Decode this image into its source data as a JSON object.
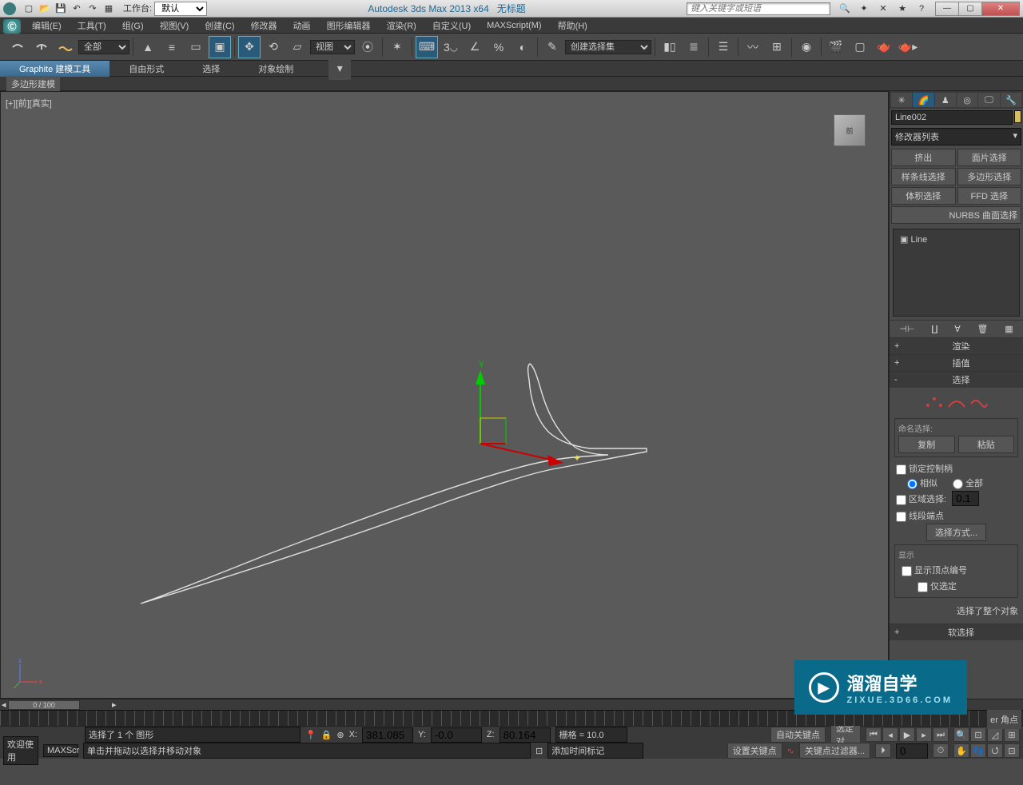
{
  "title": {
    "app": "Autodesk 3ds Max  2013 x64",
    "doc": "无标题",
    "workspace_label": "工作台:",
    "workspace_value": "默认",
    "search_placeholder": "键入关键字或短语"
  },
  "menus": [
    "编辑(E)",
    "工具(T)",
    "组(G)",
    "视图(V)",
    "创建(C)",
    "修改器",
    "动画",
    "图形编辑器",
    "渲染(R)",
    "自定义(U)",
    "MAXScript(M)",
    "帮助(H)"
  ],
  "toolbar": {
    "filter_all": "全部",
    "view_dropdown": "视图",
    "selection_set": "创建选择集"
  },
  "ribbon": {
    "tabs": [
      "Graphite 建模工具",
      "自由形式",
      "选择",
      "对象绘制"
    ],
    "sub": "多边形建模"
  },
  "viewport": {
    "label": "[+][前][真实]",
    "cube": "前"
  },
  "panel": {
    "object_name": "Line002",
    "modifier_list": "修改器列表",
    "buttons": [
      "挤出",
      "面片选择",
      "样条线选择",
      "多边形选择",
      "体积选择",
      "FFD 选择"
    ],
    "nurbs": "NURBS 曲面选择",
    "stack_item": "Line",
    "rollouts": {
      "render": "渲染",
      "interp": "插值",
      "selection": "选择",
      "soft": "软选择"
    },
    "selection_body": {
      "named_sel": "命名选择:",
      "copy": "复制",
      "paste": "粘贴",
      "lock_handles": "锁定控制柄",
      "similar": "相似",
      "all": "全部",
      "area_sel": "区域选择:",
      "area_val": "0.1",
      "seg_end": "线段端点",
      "sel_method": "选择方式...",
      "display": "显示",
      "show_vertex_num": "显示顶点编号",
      "only_selected": "仅选定",
      "whole_object": "选择了整个对象"
    },
    "bezier_label": "er 角点"
  },
  "timeline": {
    "frame": "0 / 100"
  },
  "status": {
    "selected_msg": "选择了 1 个 图形",
    "prompt": "单击并拖动以选择并移动对象",
    "welcome": "欢迎使用",
    "maxscr": "MAXScr",
    "x": "381.085",
    "y": "-0.0",
    "z": "80.164",
    "grid": "栅格 = 10.0",
    "add_marker": "添加时间标记",
    "auto_key": "自动关键点",
    "sel_pair": "选定对",
    "set_key": "设置关键点",
    "key_filter": "关键点过滤器...",
    "frame_field": "0"
  },
  "coords_labels": {
    "x": "X:",
    "y": "Y:",
    "z": "Z:"
  },
  "watermark": {
    "main": "溜溜自学",
    "sub": "ZIXUE.3D66.COM"
  }
}
